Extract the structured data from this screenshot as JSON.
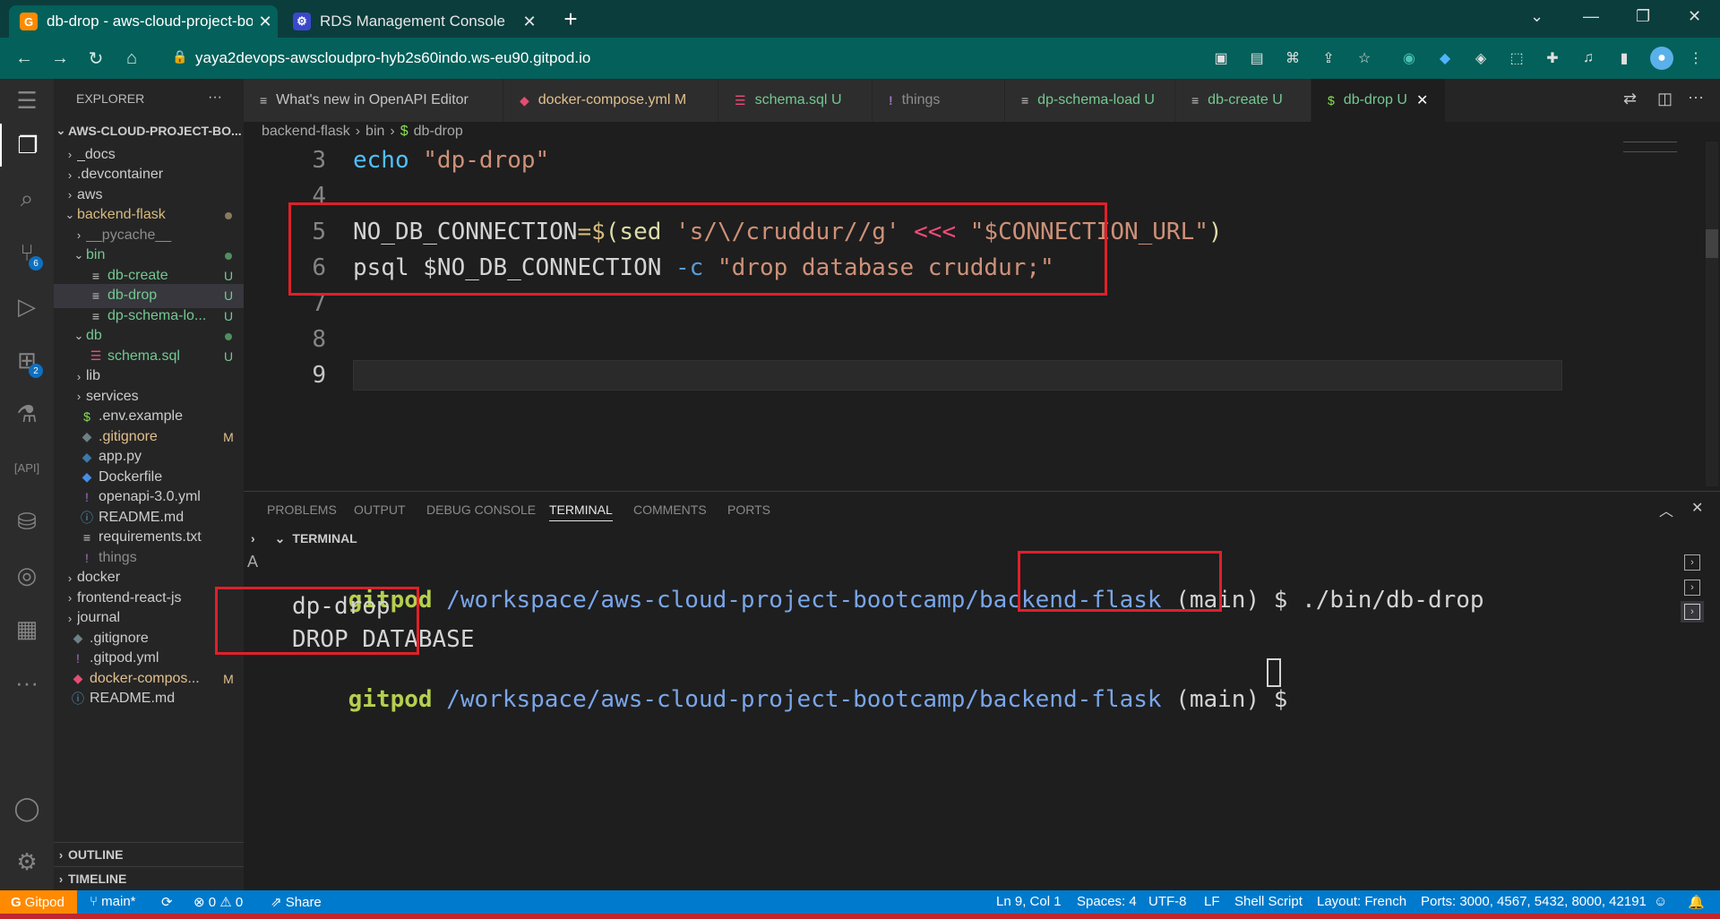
{
  "browser": {
    "tabs": [
      {
        "title": "db-drop - aws-cloud-project-boo",
        "favicon": "gitpod-icon",
        "active": true
      },
      {
        "title": "RDS Management Console",
        "favicon": "rds-icon",
        "active": false
      }
    ],
    "new_tab_glyph": "+",
    "url": "yaya2devops-awscloudpro-hyb2s60indo.ws-eu90.gitpod.io",
    "window_controls": {
      "min": "⌄",
      "restore": "—",
      "max": "❐",
      "close": "✕"
    }
  },
  "explorer": {
    "header": "EXPLORER",
    "more": "···",
    "root": "AWS-CLOUD-PROJECT-BO...",
    "items": [
      {
        "label": "_docs",
        "type": "folder",
        "open": false,
        "indent": 1,
        "status": ""
      },
      {
        "label": ".devcontainer",
        "type": "folder",
        "open": false,
        "indent": 1,
        "status": ""
      },
      {
        "label": "aws",
        "type": "folder",
        "open": false,
        "indent": 1,
        "status": ""
      },
      {
        "label": "backend-flask",
        "type": "folder",
        "open": true,
        "indent": 1,
        "status": "dot-gray"
      },
      {
        "label": "__pycache__",
        "type": "folder",
        "open": false,
        "indent": 2,
        "status": ""
      },
      {
        "label": "bin",
        "type": "folder",
        "open": true,
        "indent": 2,
        "status": "dot-green"
      },
      {
        "label": "db-create",
        "type": "sh",
        "indent": 3,
        "status": "U"
      },
      {
        "label": "db-drop",
        "type": "sh",
        "indent": 3,
        "status": "U",
        "selected": true
      },
      {
        "label": "dp-schema-lo...",
        "type": "sh",
        "indent": 3,
        "status": "U"
      },
      {
        "label": "db",
        "type": "folder",
        "open": true,
        "indent": 2,
        "status": "dot-green"
      },
      {
        "label": "schema.sql",
        "type": "sql",
        "indent": 3,
        "status": "U"
      },
      {
        "label": "lib",
        "type": "folder",
        "open": false,
        "indent": 2,
        "status": ""
      },
      {
        "label": "services",
        "type": "folder",
        "open": false,
        "indent": 2,
        "status": ""
      },
      {
        "label": ".env.example",
        "type": "dollar",
        "indent": 2,
        "status": ""
      },
      {
        "label": ".gitignore",
        "type": "git",
        "indent": 2,
        "status": "M"
      },
      {
        "label": "app.py",
        "type": "py",
        "indent": 2,
        "status": ""
      },
      {
        "label": "Dockerfile",
        "type": "docker",
        "indent": 2,
        "status": ""
      },
      {
        "label": "openapi-3.0.yml",
        "type": "yml",
        "indent": 2,
        "status": ""
      },
      {
        "label": "README.md",
        "type": "info",
        "indent": 2,
        "status": ""
      },
      {
        "label": "requirements.txt",
        "type": "txt",
        "indent": 2,
        "status": ""
      },
      {
        "label": "things",
        "type": "yml-dim",
        "indent": 2,
        "status": ""
      },
      {
        "label": "docker",
        "type": "folder",
        "open": false,
        "indent": 1,
        "status": ""
      },
      {
        "label": "frontend-react-js",
        "type": "folder",
        "open": false,
        "indent": 1,
        "status": ""
      },
      {
        "label": "journal",
        "type": "folder",
        "open": false,
        "indent": 1,
        "status": ""
      },
      {
        "label": ".gitignore",
        "type": "git",
        "indent": 1,
        "status": ""
      },
      {
        "label": ".gitpod.yml",
        "type": "yml",
        "indent": 1,
        "status": ""
      },
      {
        "label": "docker-compos...",
        "type": "docker-red",
        "indent": 1,
        "status": "M"
      },
      {
        "label": "README.md",
        "type": "info",
        "indent": 1,
        "status": ""
      }
    ],
    "outline": "OUTLINE",
    "timeline": "TIMELINE"
  },
  "activity": {
    "scm_badge": "6",
    "ext_badge": "2"
  },
  "editor_tabs": [
    {
      "label": "What's new in OpenAPI Editor",
      "icon": "≡",
      "status": ""
    },
    {
      "label": "docker-compose.yml",
      "icon": "🐳",
      "status": "M"
    },
    {
      "label": "schema.sql",
      "icon": "☰",
      "status": "U"
    },
    {
      "label": "things",
      "icon": "!",
      "status": ""
    },
    {
      "label": "dp-schema-load",
      "icon": "≡",
      "status": "U"
    },
    {
      "label": "db-create",
      "icon": "≡",
      "status": "U"
    },
    {
      "label": "db-drop",
      "icon": "$",
      "status": "U",
      "active": true
    }
  ],
  "breadcrumb": [
    "backend-flask",
    "bin",
    "db-drop"
  ],
  "code": {
    "line_numbers": [
      "3",
      "4",
      "5",
      "6",
      "7",
      "8",
      "9"
    ],
    "line3": {
      "kw": "echo",
      "str": "\"dp-drop\""
    },
    "line5": {
      "var": "NO_DB_CONNECTION",
      "eq": "=$",
      "open": "(sed ",
      "sedarg": "'s/\\/cruddur//g'",
      "op": "<<<",
      "str": "\"$CONNECTION_URL\"",
      "close": ")"
    },
    "line6": {
      "cmd": "psql $NO_DB_CONNECTION ",
      "flag": "-c",
      "str": "\"drop database cruddur;\""
    }
  },
  "panel": {
    "tabs": [
      "PROBLEMS",
      "OUTPUT",
      "DEBUG CONSOLE",
      "TERMINAL",
      "COMMENTS",
      "PORTS"
    ],
    "active_tab": "TERMINAL",
    "section": "TERMINAL",
    "terminal": {
      "prompt_user": "gitpod",
      "prompt_path": "/workspace/aws-cloud-project-bootcamp/backend-flask",
      "prompt_branch": "(main) $",
      "command": " ./bin/db-drop",
      "output": [
        "dp-drop",
        "DROP DATABASE"
      ]
    }
  },
  "statusbar": {
    "gitpod": "Gitpod",
    "branch": "main*",
    "sync": "⟳",
    "problems": "⊗ 0 ⚠ 0",
    "share": "Share",
    "position": "Ln 9, Col 1",
    "spaces": "Spaces: 4",
    "encoding": "UTF-8",
    "eol": "LF",
    "language": "Shell Script",
    "layout": "Layout: French",
    "ports": "Ports: 3000, 4567, 5432, 8000, 42191"
  },
  "colors": {
    "tab_bar": "#0b3d3d",
    "address_bar": "#04605a",
    "status_bar": "#007acc",
    "annotation_red": "#e0202a",
    "git_untracked": "#73c991",
    "git_modified": "#e2c08d"
  }
}
